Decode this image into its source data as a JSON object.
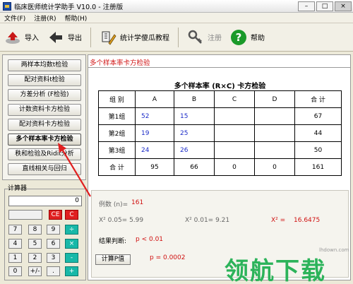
{
  "window": {
    "title": "临床医师统计学助手 V10.0 - 注册版"
  },
  "menu": [
    "文件(F)",
    "注册(R)",
    "帮助(H)"
  ],
  "toolbar": {
    "import": "导入",
    "export": "导出",
    "tutorial": "统计学傻瓜教程",
    "register": "注册",
    "help": "帮助"
  },
  "nav": [
    "两样本均数t检验",
    "配对资料t检验",
    "方差分析 (F检验)",
    "计数资料卡方检验",
    "配对资料卡方检验",
    "多个样本率卡方检验",
    "秩和检验及Ridit分析",
    "直线相关与回归"
  ],
  "calc": {
    "label": "计算器",
    "display": "0",
    "keys": [
      [
        "",
        "",
        "CE",
        "C"
      ],
      [
        "7",
        "8",
        "9",
        "÷"
      ],
      [
        "4",
        "5",
        "6",
        "×"
      ],
      [
        "1",
        "2",
        "3",
        "-"
      ],
      [
        "0",
        "+/-",
        ".",
        "+"
      ]
    ]
  },
  "panel": {
    "title": "多个样本率卡方检验",
    "table_title": "多个样本率 (R×C) 卡方检验",
    "headers": [
      "组  别",
      "A",
      "B",
      "C",
      "D",
      "合  计"
    ],
    "rows": [
      [
        "第1组",
        "52",
        "15",
        "",
        "",
        "67"
      ],
      [
        "第2组",
        "19",
        "25",
        "",
        "",
        "44"
      ],
      [
        "第3组",
        "24",
        "26",
        "",
        "",
        "50"
      ],
      [
        "合  计",
        "95",
        "66",
        "0",
        "0",
        "161"
      ]
    ]
  },
  "stats": {
    "n_label": "例数 (n)=",
    "n_value": "161",
    "chi05": "X² 0.05= 5.99",
    "chi01": "X² 0.01= 9.21",
    "chi_label": "X² =",
    "chi_value": "16.6475",
    "result_label": "结果判断:",
    "result_value": "p < 0.01",
    "calc_btn": "计算P值",
    "p_value": "p = 0.0002"
  },
  "watermark": {
    "text": "领航下载",
    "url": "lhdown.com"
  }
}
